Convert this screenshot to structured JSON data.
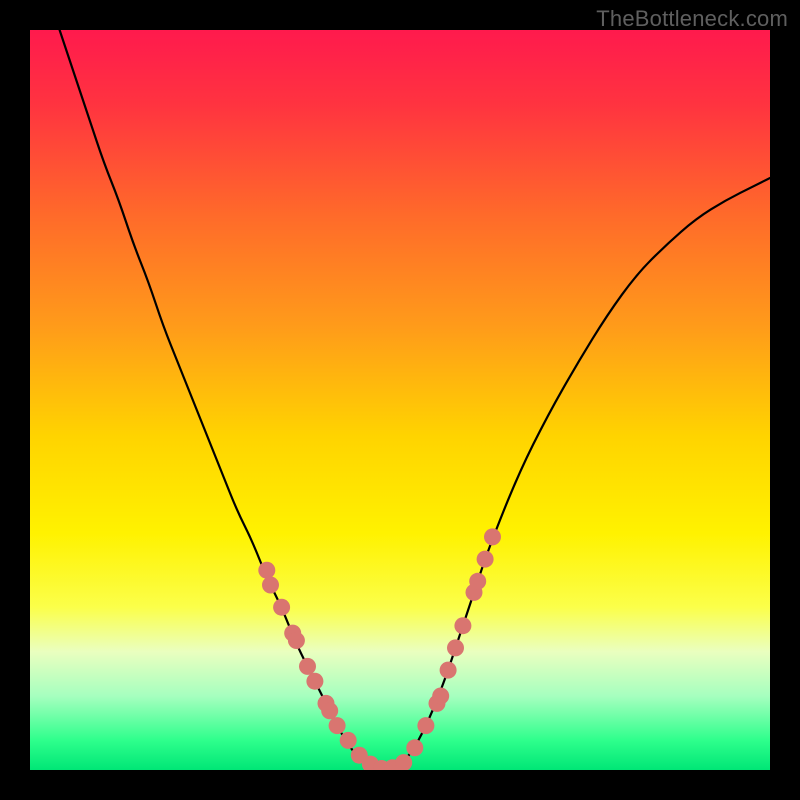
{
  "watermark": "TheBottleneck.com",
  "chart_data": {
    "type": "line",
    "title": "",
    "xlabel": "",
    "ylabel": "",
    "xlim": [
      0,
      1
    ],
    "ylim": [
      0,
      1
    ],
    "series": [
      {
        "name": "bottleneck-curve",
        "x": [
          0.04,
          0.06,
          0.08,
          0.1,
          0.12,
          0.14,
          0.16,
          0.18,
          0.2,
          0.22,
          0.24,
          0.26,
          0.28,
          0.3,
          0.32,
          0.34,
          0.36,
          0.38,
          0.4,
          0.42,
          0.44,
          0.46,
          0.48,
          0.5,
          0.52,
          0.54,
          0.56,
          0.58,
          0.6,
          0.62,
          0.66,
          0.7,
          0.74,
          0.78,
          0.82,
          0.86,
          0.9,
          0.94,
          0.98,
          1.0
        ],
        "y": [
          1.0,
          0.94,
          0.88,
          0.82,
          0.77,
          0.71,
          0.66,
          0.6,
          0.55,
          0.5,
          0.45,
          0.4,
          0.35,
          0.31,
          0.26,
          0.22,
          0.17,
          0.13,
          0.09,
          0.05,
          0.02,
          0.005,
          0.0,
          0.005,
          0.03,
          0.07,
          0.12,
          0.18,
          0.24,
          0.3,
          0.4,
          0.48,
          0.55,
          0.615,
          0.67,
          0.71,
          0.745,
          0.77,
          0.79,
          0.8
        ]
      }
    ],
    "markers": {
      "name": "salmon-dots",
      "color": "#d97570",
      "points": [
        {
          "x": 0.32,
          "y": 0.27
        },
        {
          "x": 0.325,
          "y": 0.25
        },
        {
          "x": 0.34,
          "y": 0.22
        },
        {
          "x": 0.355,
          "y": 0.185
        },
        {
          "x": 0.36,
          "y": 0.175
        },
        {
          "x": 0.375,
          "y": 0.14
        },
        {
          "x": 0.385,
          "y": 0.12
        },
        {
          "x": 0.4,
          "y": 0.09
        },
        {
          "x": 0.405,
          "y": 0.08
        },
        {
          "x": 0.415,
          "y": 0.06
        },
        {
          "x": 0.43,
          "y": 0.04
        },
        {
          "x": 0.445,
          "y": 0.02
        },
        {
          "x": 0.46,
          "y": 0.008
        },
        {
          "x": 0.475,
          "y": 0.002
        },
        {
          "x": 0.49,
          "y": 0.003
        },
        {
          "x": 0.505,
          "y": 0.01
        },
        {
          "x": 0.52,
          "y": 0.03
        },
        {
          "x": 0.535,
          "y": 0.06
        },
        {
          "x": 0.55,
          "y": 0.09
        },
        {
          "x": 0.555,
          "y": 0.1
        },
        {
          "x": 0.565,
          "y": 0.135
        },
        {
          "x": 0.575,
          "y": 0.165
        },
        {
          "x": 0.585,
          "y": 0.195
        },
        {
          "x": 0.6,
          "y": 0.24
        },
        {
          "x": 0.605,
          "y": 0.255
        },
        {
          "x": 0.615,
          "y": 0.285
        },
        {
          "x": 0.625,
          "y": 0.315
        }
      ]
    },
    "gradient_stops": [
      {
        "offset": 0.0,
        "color": "#ff1a4d"
      },
      {
        "offset": 0.1,
        "color": "#ff3340"
      },
      {
        "offset": 0.25,
        "color": "#ff6a2a"
      },
      {
        "offset": 0.4,
        "color": "#ff9b1a"
      },
      {
        "offset": 0.55,
        "color": "#ffd400"
      },
      {
        "offset": 0.68,
        "color": "#fff200"
      },
      {
        "offset": 0.78,
        "color": "#fbff4a"
      },
      {
        "offset": 0.84,
        "color": "#eaffbf"
      },
      {
        "offset": 0.9,
        "color": "#a6ffbf"
      },
      {
        "offset": 0.96,
        "color": "#2eff8c"
      },
      {
        "offset": 1.0,
        "color": "#00e676"
      }
    ]
  }
}
